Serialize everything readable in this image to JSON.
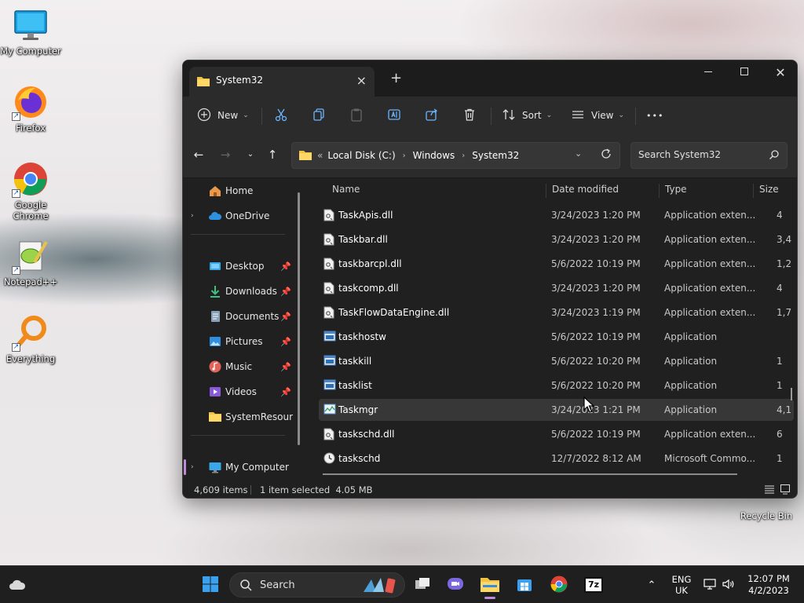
{
  "desktop": {
    "icons": [
      {
        "label": "My Computer"
      },
      {
        "label": "Firefox"
      },
      {
        "label": "Google Chrome"
      },
      {
        "label": "Notepad++"
      },
      {
        "label": "Everything"
      }
    ],
    "recycle_bin": "Recycle Bin"
  },
  "window": {
    "tab_title": "System32",
    "new_tab": "+",
    "controls": {
      "minimize": "—",
      "maximize": "☐",
      "close": "✕"
    }
  },
  "commandbar": {
    "new_label": "New",
    "sort_label": "Sort",
    "view_label": "View",
    "more": "•••"
  },
  "address": {
    "overflow": "«",
    "crumbs": [
      "Local Disk (C:)",
      "Windows",
      "System32"
    ],
    "search_placeholder": "Search System32"
  },
  "navpane": {
    "items": [
      {
        "label": "Home"
      },
      {
        "label": "OneDrive"
      },
      {
        "label": "Desktop"
      },
      {
        "label": "Downloads"
      },
      {
        "label": "Documents"
      },
      {
        "label": "Pictures"
      },
      {
        "label": "Music"
      },
      {
        "label": "Videos"
      },
      {
        "label": "SystemResources"
      },
      {
        "label": "My Computer"
      }
    ]
  },
  "filelist": {
    "columns": {
      "name": "Name",
      "date": "Date modified",
      "type": "Type",
      "size": "Size"
    },
    "rows": [
      {
        "name": "TaskApis.dll",
        "date": "3/24/2023 1:20 PM",
        "type": "Application exten...",
        "size": "4",
        "icon": "dll"
      },
      {
        "name": "Taskbar.dll",
        "date": "3/24/2023 1:20 PM",
        "type": "Application exten...",
        "size": "3,4",
        "icon": "dll"
      },
      {
        "name": "taskbarcpl.dll",
        "date": "5/6/2022 10:19 PM",
        "type": "Application exten...",
        "size": "1,2",
        "icon": "dll"
      },
      {
        "name": "taskcomp.dll",
        "date": "3/24/2023 1:20 PM",
        "type": "Application exten...",
        "size": "4",
        "icon": "dll"
      },
      {
        "name": "TaskFlowDataEngine.dll",
        "date": "3/24/2023 1:19 PM",
        "type": "Application exten...",
        "size": "1,7",
        "icon": "dll"
      },
      {
        "name": "taskhostw",
        "date": "5/6/2022 10:19 PM",
        "type": "Application",
        "size": "",
        "icon": "app"
      },
      {
        "name": "taskkill",
        "date": "5/6/2022 10:20 PM",
        "type": "Application",
        "size": "1",
        "icon": "app"
      },
      {
        "name": "tasklist",
        "date": "5/6/2022 10:20 PM",
        "type": "Application",
        "size": "1",
        "icon": "app"
      },
      {
        "name": "Taskmgr",
        "date": "3/24/2023 1:21 PM",
        "type": "Application",
        "size": "4,1",
        "icon": "taskmgr"
      },
      {
        "name": "taskschd.dll",
        "date": "5/6/2022 10:19 PM",
        "type": "Application exten...",
        "size": "6",
        "icon": "dll"
      },
      {
        "name": "taskschd",
        "date": "12/7/2022 8:12 AM",
        "type": "Microsoft Commo...",
        "size": "1",
        "icon": "clock"
      }
    ]
  },
  "statusbar": {
    "item_count": "4,609 items",
    "selection": "1 item selected  4.05 MB"
  },
  "taskbar": {
    "search_label": "Search",
    "lang_line1": "ENG",
    "lang_line2": "UK",
    "time": "12:07 PM",
    "date": "4/2/2023",
    "zip_label": "7z"
  }
}
